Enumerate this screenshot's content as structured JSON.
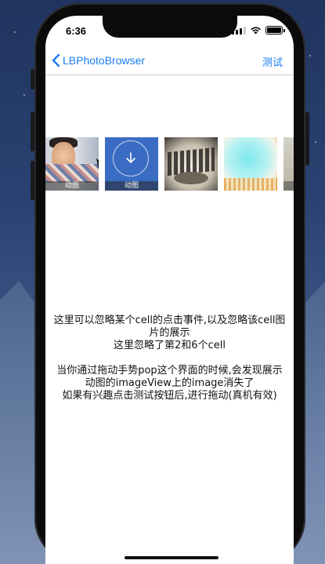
{
  "status_bar": {
    "time": "6:36"
  },
  "nav": {
    "back_label": "LBPhotoBrowser",
    "right_label": "测试"
  },
  "thumbs": [
    {
      "tag": "动图"
    },
    {
      "tag": "动图"
    },
    {
      "tag": ""
    },
    {
      "tag": ""
    },
    {
      "tag": ""
    }
  ],
  "description": {
    "line1": "这里可以忽略某个cell的点击事件,以及忽略该cell图片的展示",
    "line2": "这里忽略了第2和6个cell",
    "line3": "当你通过拖动手势pop这个界面的时候,会发现展示动图的imageView上的image消失了",
    "line4": "如果有兴趣点击测试按钮后,进行拖动(真机有效)"
  },
  "colors": {
    "accent": "#1a7cf0",
    "download_tile": "#3a6cc4"
  }
}
